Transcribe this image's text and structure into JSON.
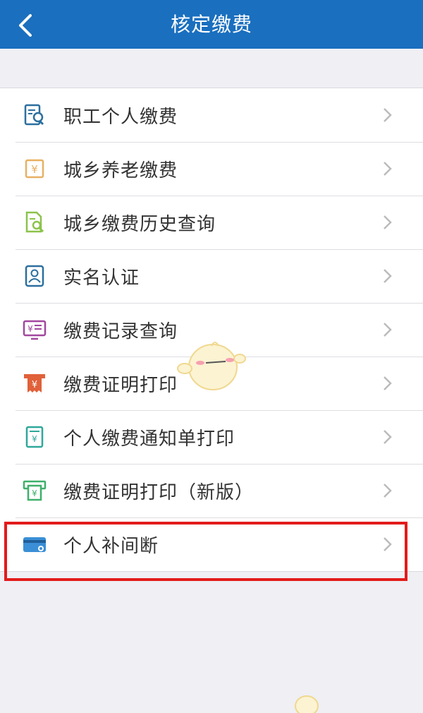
{
  "header": {
    "back_icon": "chevron-left-icon",
    "title": "核定缴费"
  },
  "colors": {
    "header_bg": "#1a6fbf",
    "highlight_border": "#e21b1b"
  },
  "menu": {
    "items": [
      {
        "label": "职工个人缴费",
        "icon": "employee-payment-icon"
      },
      {
        "label": "城乡养老缴费",
        "icon": "yuan-box-icon"
      },
      {
        "label": "城乡缴费历史查询",
        "icon": "document-search-icon"
      },
      {
        "label": "实名认证",
        "icon": "id-card-icon"
      },
      {
        "label": "缴费记录查询",
        "icon": "monitor-yuan-icon"
      },
      {
        "label": "缴费证明打印",
        "icon": "receipt-print-icon"
      },
      {
        "label": "个人缴费通知单打印",
        "icon": "notice-print-icon"
      },
      {
        "label": "缴费证明打印（新版）",
        "icon": "certificate-print-icon"
      },
      {
        "label": "个人补间断",
        "icon": "credit-card-icon",
        "highlighted": true
      }
    ]
  }
}
